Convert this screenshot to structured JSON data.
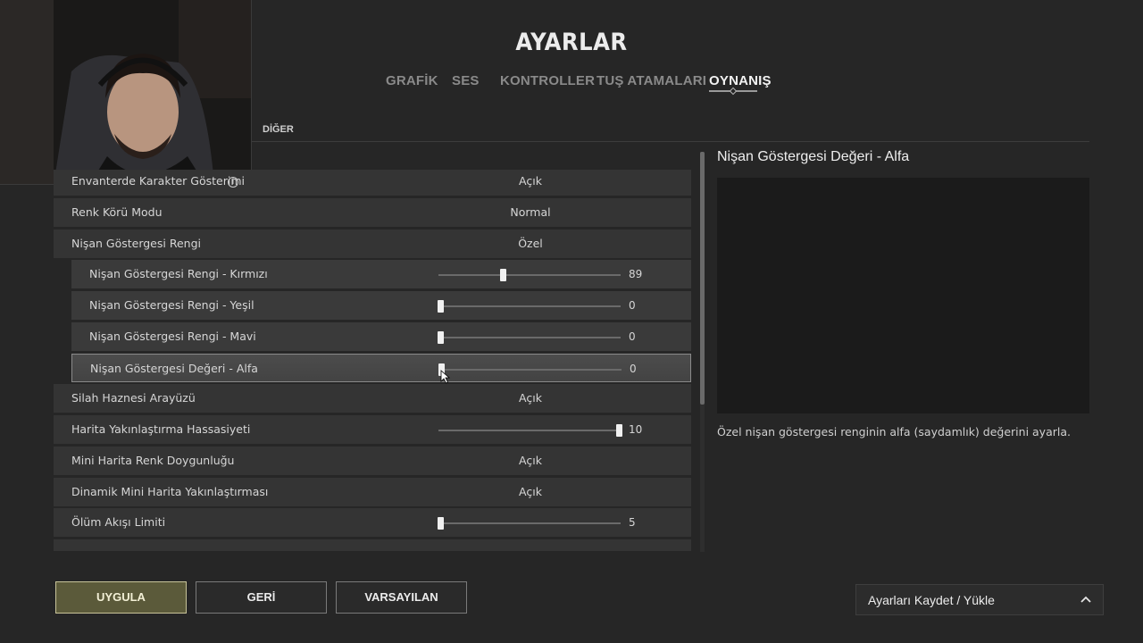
{
  "header": {
    "title": "AYARLAR",
    "tabs": [
      "GRAFİK",
      "SES",
      "KONTROLLER",
      "TUŞ ATAMALARI",
      "OYNANIŞ"
    ],
    "active_tab": "OYNANIŞ"
  },
  "section": {
    "label": "DİĞER"
  },
  "settings": [
    {
      "label": "Envanterde Karakter Gösterimi",
      "value": "Açık",
      "type": "toggle",
      "info": true
    },
    {
      "label": "Renk Körü Modu",
      "value": "Normal",
      "type": "select"
    },
    {
      "label": "Nişan Göstergesi Rengi",
      "value": "Özel",
      "type": "select"
    },
    {
      "label": "Nişan Göstergesi Rengi - Kırmızı",
      "value": "89",
      "type": "slider",
      "level": 0.35,
      "sub": true
    },
    {
      "label": "Nişan Göstergesi Rengi - Yeşil",
      "value": "0",
      "type": "slider",
      "level": 0,
      "sub": true
    },
    {
      "label": "Nişan Göstergesi Rengi - Mavi",
      "value": "0",
      "type": "slider",
      "level": 0,
      "sub": true
    },
    {
      "label": "Nişan Göstergesi Değeri - Alfa",
      "value": "0",
      "type": "slider",
      "level": 0,
      "sub": true,
      "selected": true
    },
    {
      "label": "Silah Haznesi Arayüzü",
      "value": "Açık",
      "type": "toggle"
    },
    {
      "label": "Harita Yakınlaştırma Hassasiyeti",
      "value": "10",
      "type": "slider",
      "level": 1.0
    },
    {
      "label": "Mini Harita Renk Doygunluğu",
      "value": "Açık",
      "type": "toggle"
    },
    {
      "label": "Dinamik Mini Harita Yakınlaştırması",
      "value": "Açık",
      "type": "toggle"
    },
    {
      "label": "Ölüm Akışı Limiti",
      "value": "5",
      "type": "slider",
      "level": 0
    }
  ],
  "detail": {
    "title": "Nişan Göstergesi Değeri - Alfa",
    "description": "Özel nişan göstergesi renginin alfa (saydamlık) değerini ayarla."
  },
  "buttons": {
    "apply": "UYGULA",
    "back": "GERİ",
    "default": "VARSAYILAN"
  },
  "save_load": {
    "label": "Ayarları Kaydet / Yükle"
  },
  "colors": {
    "accent": "#5b5a3a",
    "accent_border": "#c8c49a",
    "background": "#262626"
  }
}
